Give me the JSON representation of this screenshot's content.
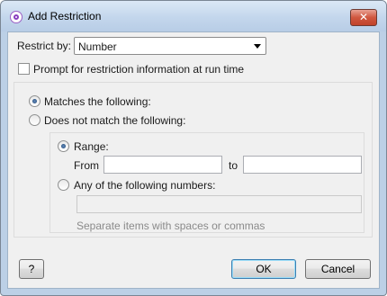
{
  "window": {
    "title": "Add Restriction",
    "close_glyph": "✕"
  },
  "restrict_by": {
    "label": "Restrict by:",
    "value": "Number"
  },
  "prompt_checkbox": {
    "label": "Prompt for restriction information at run time",
    "checked": false
  },
  "match_options": {
    "matches": {
      "label": "Matches the following:",
      "checked": true
    },
    "not_match": {
      "label": "Does not match the following:",
      "checked": false
    }
  },
  "range": {
    "label": "Range:",
    "checked": true,
    "from_label": "From",
    "from_value": "",
    "to_label": "to",
    "to_value": ""
  },
  "any_numbers": {
    "label": "Any of the following numbers:",
    "checked": false,
    "value": "",
    "hint": "Separate items with spaces or commas"
  },
  "buttons": {
    "help": "?",
    "ok": "OK",
    "cancel": "Cancel"
  }
}
